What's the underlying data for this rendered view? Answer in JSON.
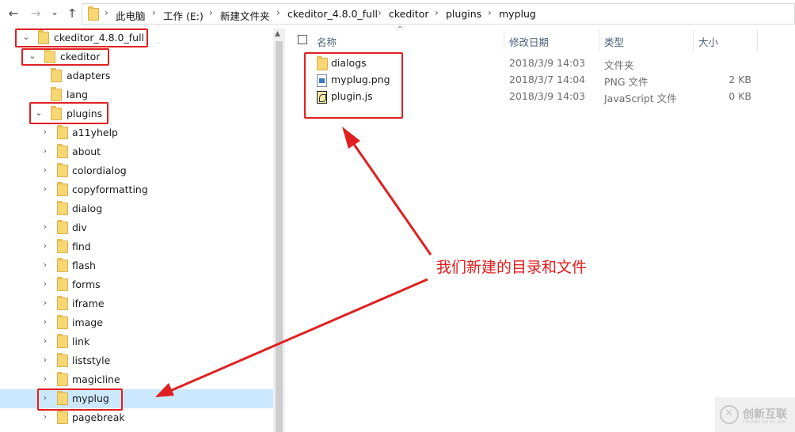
{
  "nav": {
    "back": "←",
    "forward": "→",
    "recent": "⌄",
    "up": "↑"
  },
  "breadcrumb": [
    "此电脑",
    "工作 (E:)",
    "新建文件夹",
    "ckeditor_4.8.0_full",
    "ckeditor",
    "plugins",
    "myplug"
  ],
  "tree": [
    {
      "label": "ckeditor_4.8.0_full",
      "chev": "⌄"
    },
    {
      "label": "ckeditor",
      "chev": "⌄"
    },
    {
      "label": "adapters",
      "chev": ""
    },
    {
      "label": "lang",
      "chev": ""
    },
    {
      "label": "plugins",
      "chev": "⌄"
    },
    {
      "label": "a11yhelp",
      "chev": "›"
    },
    {
      "label": "about",
      "chev": "›"
    },
    {
      "label": "colordialog",
      "chev": "›"
    },
    {
      "label": "copyformatting",
      "chev": "›"
    },
    {
      "label": "dialog",
      "chev": ""
    },
    {
      "label": "div",
      "chev": "›"
    },
    {
      "label": "find",
      "chev": "›"
    },
    {
      "label": "flash",
      "chev": "›"
    },
    {
      "label": "forms",
      "chev": "›"
    },
    {
      "label": "iframe",
      "chev": "›"
    },
    {
      "label": "image",
      "chev": "›"
    },
    {
      "label": "link",
      "chev": "›"
    },
    {
      "label": "liststyle",
      "chev": "›"
    },
    {
      "label": "magicline",
      "chev": "›"
    },
    {
      "label": "myplug",
      "chev": "›"
    },
    {
      "label": "pagebreak",
      "chev": "›"
    }
  ],
  "columns": {
    "name": "名称",
    "date": "修改日期",
    "type": "类型",
    "size": "大小"
  },
  "files": [
    {
      "name": "dialogs",
      "date": "2018/3/9 14:03",
      "type": "文件夹",
      "size": "",
      "icon": "folder-icon"
    },
    {
      "name": "myplug.png",
      "date": "2018/3/7 14:04",
      "type": "PNG 文件",
      "size": "2 KB",
      "icon": "png-file-icon"
    },
    {
      "name": "plugin.js",
      "date": "2018/3/9 14:03",
      "type": "JavaScript 文件",
      "size": "0 KB",
      "icon": "js-file-icon"
    }
  ],
  "annotation": "我们新建的目录和文件",
  "watermark": {
    "title": "创新互联",
    "subtitle": "CHUANG XIN HU LIAN"
  },
  "colors": {
    "accent": "#e02020",
    "selection": "#cce8ff",
    "folder": "#f7d774"
  }
}
